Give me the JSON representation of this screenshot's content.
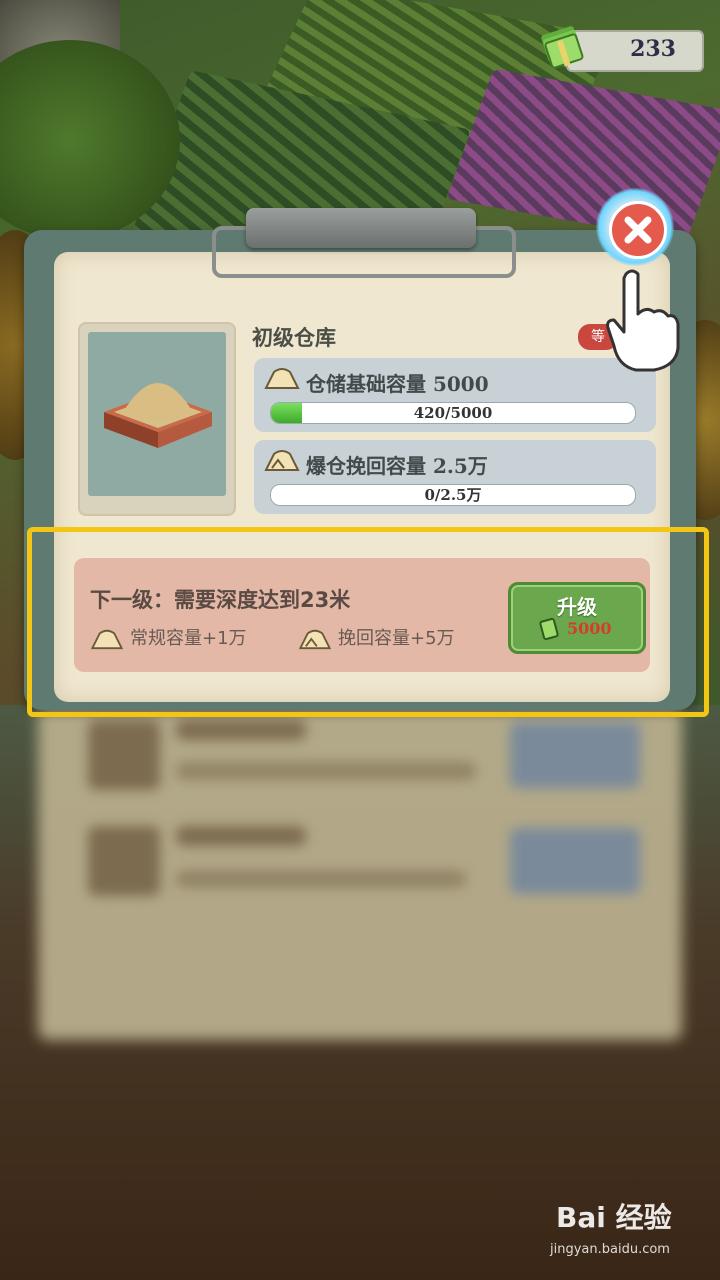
{
  "currency": {
    "amount": "233"
  },
  "warehouse": {
    "title": "初级仓库",
    "badge": "等",
    "base_capacity": {
      "label": "仓储基础容量",
      "value": "5000",
      "progress_text": "420/5000",
      "progress_fraction": 0.084
    },
    "overflow_recovery": {
      "label": "爆仓挽回容量",
      "value": "2.5万",
      "progress_text": "0/2.5万",
      "progress_fraction": 0
    }
  },
  "next_level": {
    "title": "下一级：需要深度达到23米",
    "perks": [
      "常规容量+1万",
      "挽回容量+5万"
    ],
    "upgrade_button": {
      "label": "升级",
      "cost": "5000"
    }
  },
  "colors": {
    "highlight": "#f4c614",
    "close_button": "#e45a4c",
    "upgrade_button": "#6ba84d"
  },
  "icons": [
    "cash-icon",
    "close-icon",
    "pointing-hand-icon",
    "sand-pile-icon"
  ],
  "watermark": {
    "brand": "Bai 经验",
    "url": "jingyan.baidu.com"
  }
}
